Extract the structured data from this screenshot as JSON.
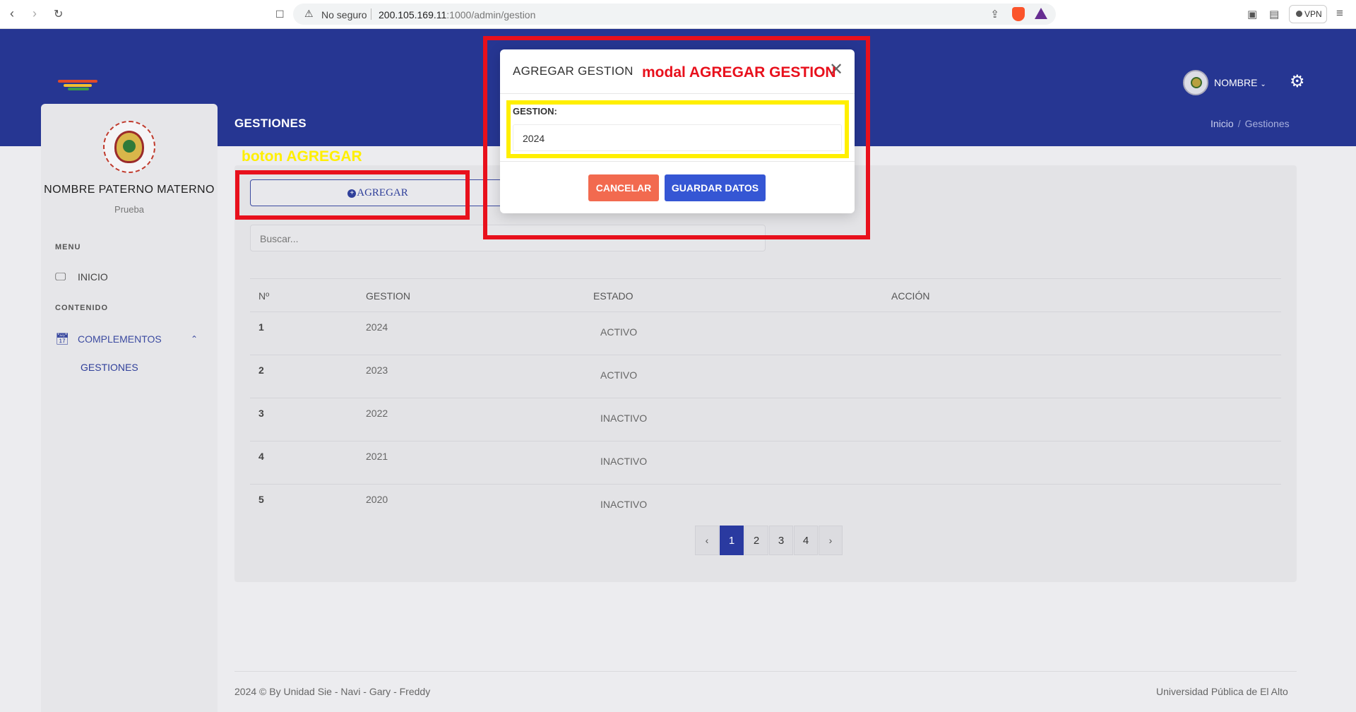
{
  "browser": {
    "security_label": "No seguro",
    "url_host": "200.105.169.11",
    "url_path": ":1000/admin/gestion",
    "vpn_label": "VPN"
  },
  "header": {
    "user_name": "NOMBRE",
    "page_title": "GESTIONES",
    "breadcrumb": [
      "Inicio",
      "Gestiones"
    ]
  },
  "sidebar": {
    "user_full_name": "NOMBRE PATERNO MATERNO",
    "user_role": "Prueba",
    "section_menu": "MENU",
    "item_inicio": "INICIO",
    "section_contenido": "CONTENIDO",
    "item_complementos": "COMPLEMENTOS",
    "sub_gestiones": "GESTIONES"
  },
  "content": {
    "add_button_label": "AGREGAR",
    "search_placeholder": "Buscar...",
    "table": {
      "headers": [
        "Nº",
        "GESTION",
        "ESTADO",
        "ACCIÓN"
      ],
      "rows": [
        {
          "n": "1",
          "gestion": "2024",
          "estado": "ACTIVO"
        },
        {
          "n": "2",
          "gestion": "2023",
          "estado": "ACTIVO"
        },
        {
          "n": "3",
          "gestion": "2022",
          "estado": "INACTIVO"
        },
        {
          "n": "4",
          "gestion": "2021",
          "estado": "INACTIVO"
        },
        {
          "n": "5",
          "gestion": "2020",
          "estado": "INACTIVO"
        }
      ]
    },
    "pagination": {
      "prev": "‹",
      "pages": [
        "1",
        "2",
        "3",
        "4"
      ],
      "next": "›",
      "current": "1"
    }
  },
  "footer": {
    "left": "2024 © By Unidad Sie - Navi - Gary - Freddy",
    "right": "Universidad Pública de El Alto"
  },
  "modal": {
    "title": "AGREGAR GESTION",
    "field_label": "GESTION:",
    "field_value": "2024",
    "cancel_label": "CANCELAR",
    "save_label": "GUARDAR DATOS"
  },
  "annotations": {
    "modal_note": "modal AGREGAR GESTION",
    "button_note": "boton AGREGAR"
  },
  "colors": {
    "header_bg": "#263692",
    "accent": "#2f3f9a",
    "active_status": "#2e9e4f",
    "inactive_status": "#d63c3c",
    "cancel_button": "#f26a4f",
    "save_button": "#3556d4",
    "annotation_red": "#e8101c",
    "annotation_yellow": "#ffef00"
  }
}
